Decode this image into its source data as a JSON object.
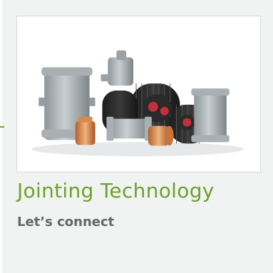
{
  "card": {
    "title": "Jointing Technology",
    "subtitle": "Let’s connect",
    "image_subject": "pipe-jointing-products-photo"
  },
  "colors": {
    "accent": "#6ea12e",
    "subtitle": "#666666",
    "card_background": "#f1f2f2",
    "image_border": "#d6d9da"
  }
}
